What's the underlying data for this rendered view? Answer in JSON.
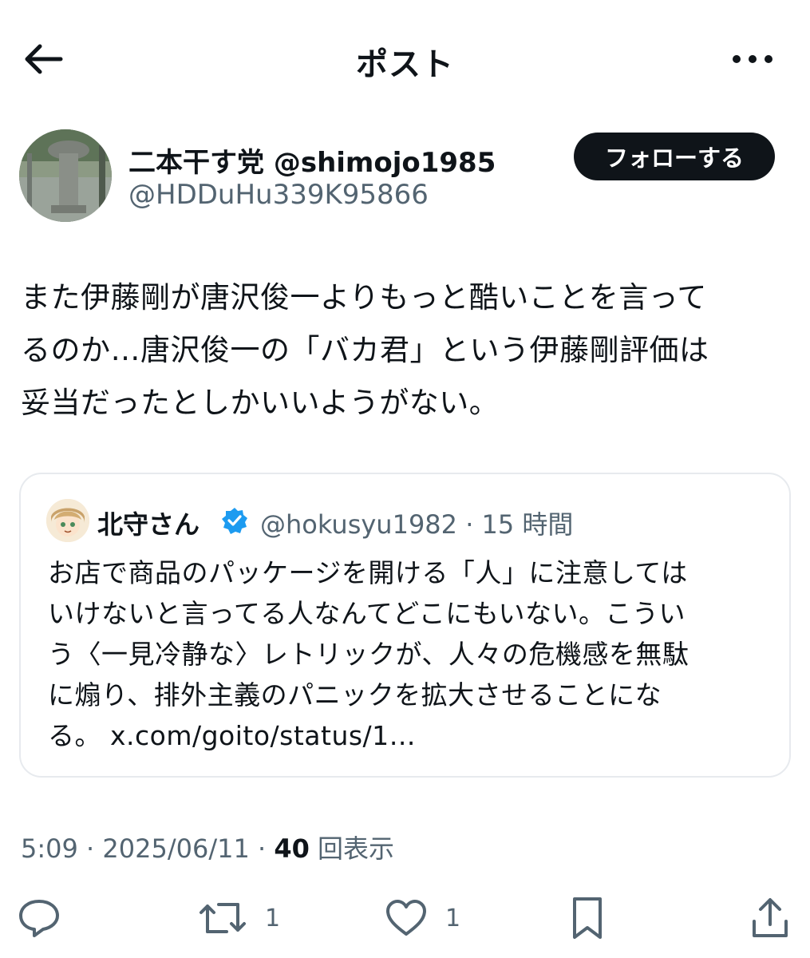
{
  "header": {
    "title": "ポスト"
  },
  "author": {
    "display_name": "二本干す党 @shimojo1985",
    "handle": "@HDDuHu339K95866",
    "follow_label": "フォローする"
  },
  "tweet": {
    "lines": [
      "また伊藤剛が唐沢俊一よりもっと酷いことを言って",
      "るのか…唐沢俊一の「バカ君」という伊藤剛評価は",
      "妥当だったとしかいいようがない。"
    ]
  },
  "quote": {
    "display_name": "北守さん",
    "meta": "@hokusyu1982 · 15 時間",
    "lines": [
      "お店で商品のパッケージを開ける「人」に注意しては",
      "いけないと言ってる人なんてどこにもいない。こうい",
      "う〈一見冷静な〉レトリックが、人々の危機感を無駄",
      "に煽り、排外主義のパニックを拡大させることにな",
      "る。 x.com/goito/status/1…"
    ]
  },
  "stats": {
    "time": "5:09 · 2025/06/11 · ",
    "views_count": "40",
    "views_label": " 回表示"
  },
  "actions": {
    "reply_count": "",
    "repost_count": "1",
    "like_count": "1"
  },
  "colors": {
    "text": "#0f1419",
    "secondary": "#536471",
    "verified": "#1d9bf0",
    "border": "#e7eaee"
  },
  "icons": [
    "back-arrow-icon",
    "more-icon",
    "verified-badge-icon",
    "reply-icon",
    "repost-icon",
    "like-icon",
    "bookmark-icon",
    "share-icon"
  ]
}
